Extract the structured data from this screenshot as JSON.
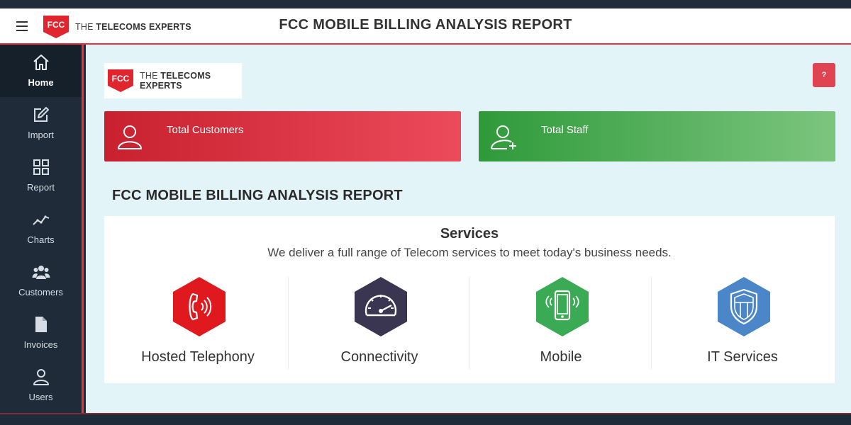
{
  "header": {
    "brand_abbr": "FCC",
    "brand_prefix": "THE",
    "brand_name": "TELECOMS EXPERTS",
    "title": "FCC MOBILE BILLING ANALYSIS REPORT"
  },
  "sidebar": {
    "items": [
      {
        "label": "Home",
        "icon": "home-icon"
      },
      {
        "label": "Import",
        "icon": "edit-icon"
      },
      {
        "label": "Report",
        "icon": "grid-icon"
      },
      {
        "label": "Charts",
        "icon": "line-chart-icon"
      },
      {
        "label": "Customers",
        "icon": "users-icon"
      },
      {
        "label": "Invoices",
        "icon": "file-icon"
      },
      {
        "label": "Users",
        "icon": "user-icon"
      }
    ]
  },
  "main": {
    "help_label": "?",
    "cards": [
      {
        "label": "Total Customers",
        "color": "#d32f3e"
      },
      {
        "label": "Total Staff",
        "color": "#43a047"
      }
    ],
    "section_title": "FCC MOBILE BILLING ANALYSIS REPORT",
    "services": {
      "heading": "Services",
      "subtitle": "We deliver a full range of Telecom services to meet today's business needs.",
      "items": [
        {
          "label": "Hosted Telephony",
          "color": "#e0191f",
          "icon": "phone-icon"
        },
        {
          "label": "Connectivity",
          "color": "#3a3550",
          "icon": "speedometer-icon"
        },
        {
          "label": "Mobile",
          "color": "#3aaa55",
          "icon": "mobile-icon"
        },
        {
          "label": "IT Services",
          "color": "#4a86c8",
          "icon": "shield-icon"
        }
      ]
    }
  },
  "colors": {
    "accent": "#e8323f",
    "sidebar_bg": "#1f2b38",
    "main_bg": "#e3f4f9"
  }
}
